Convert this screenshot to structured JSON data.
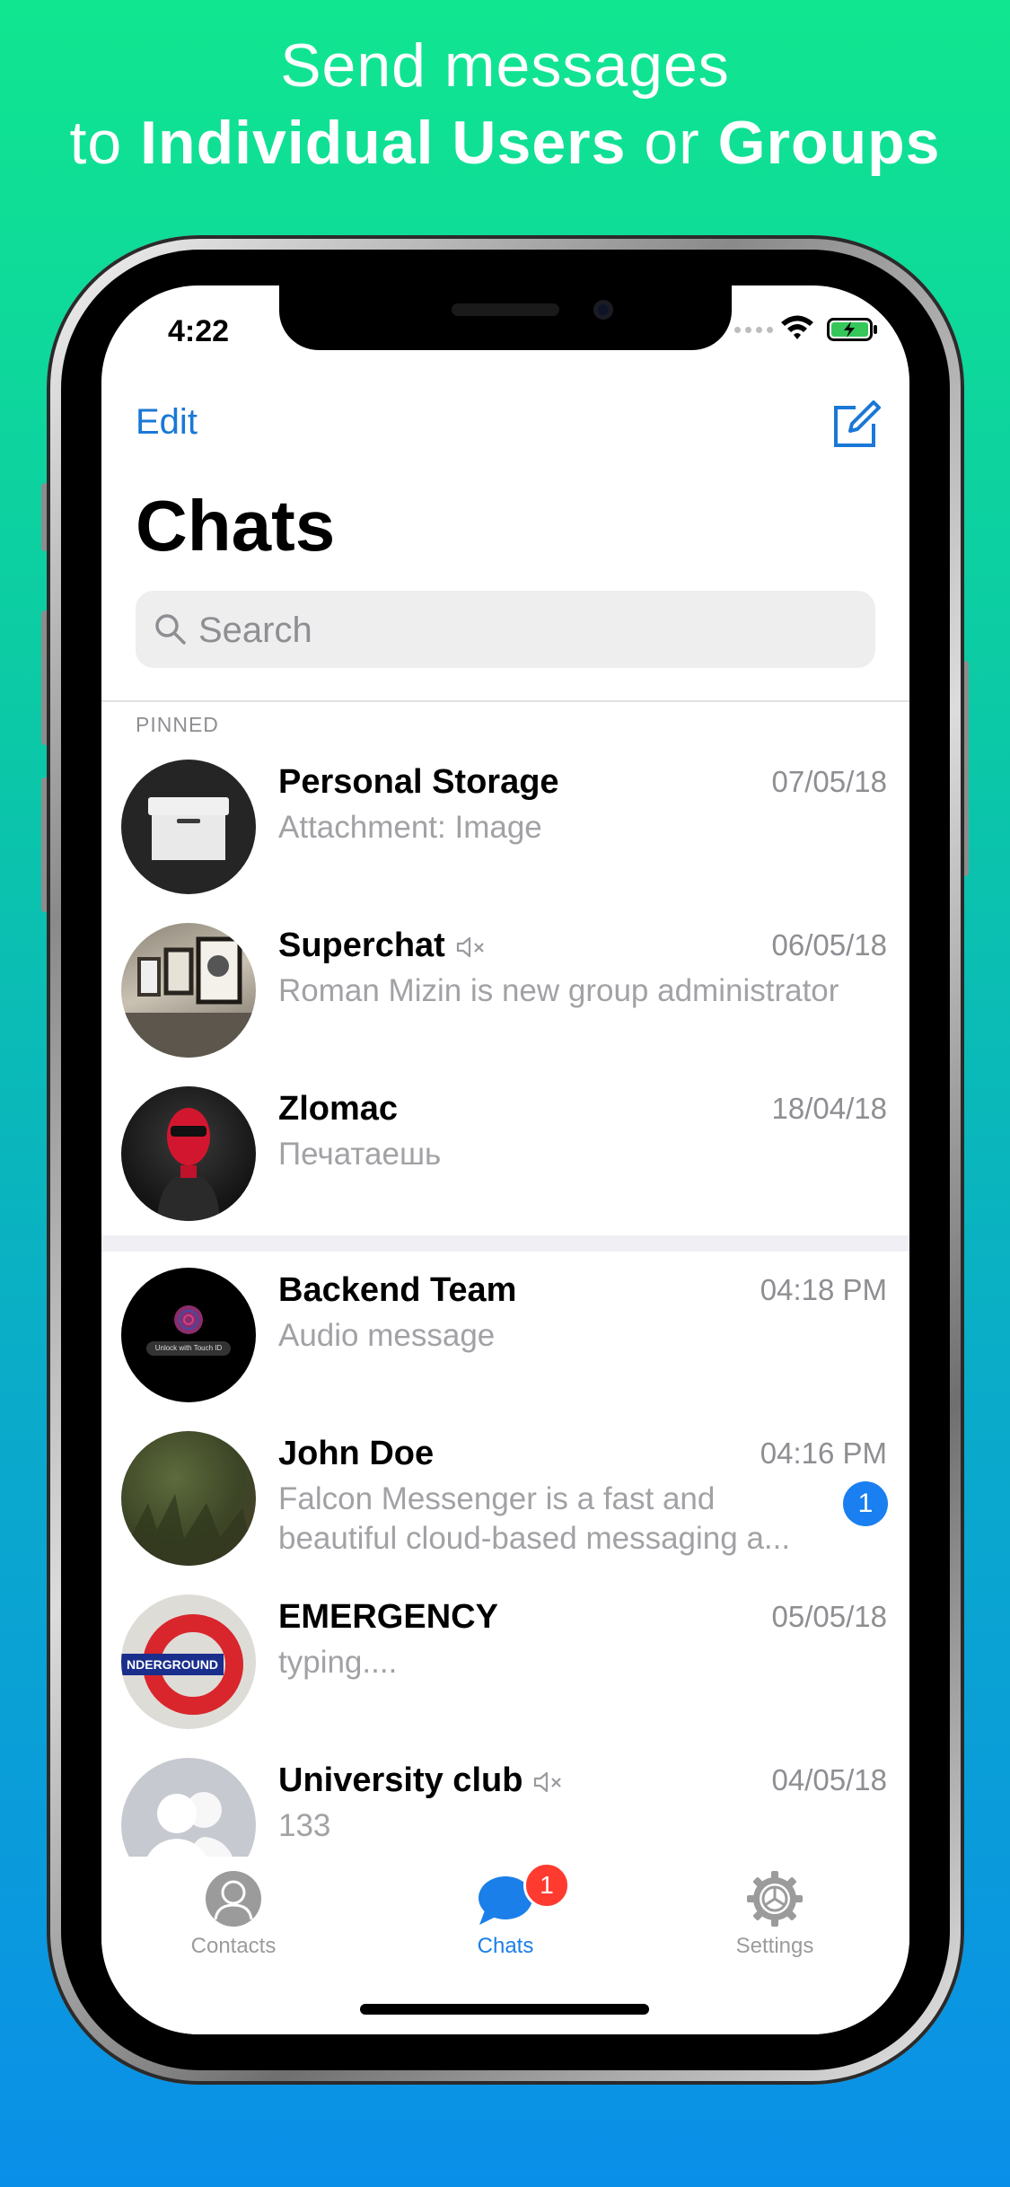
{
  "headline": {
    "line1": "Send messages",
    "line2_prefix": "to ",
    "line2_bold1": "Individual Users",
    "line2_middle": " or ",
    "line2_bold2": "Groups"
  },
  "status_bar": {
    "time": "4:22"
  },
  "nav": {
    "edit_label": "Edit",
    "title": "Chats"
  },
  "search": {
    "placeholder": "Search"
  },
  "section_label": "PINNED",
  "chats": [
    {
      "name": "Personal Storage",
      "date": "07/05/18",
      "preview": "Attachment: Image",
      "muted": false,
      "pinned": true
    },
    {
      "name": "Superchat",
      "date": "06/05/18",
      "preview": "Roman Mizin is new group administrator",
      "muted": true,
      "pinned": true
    },
    {
      "name": "Zlomac",
      "date": "18/04/18",
      "preview": "Печатаешь",
      "muted": false,
      "pinned": true
    },
    {
      "name": "Backend Team",
      "date": "04:18 PM",
      "preview": "Audio message",
      "muted": false,
      "pinned": false
    },
    {
      "name": "John Doe",
      "date": "04:16 PM",
      "preview_line1": "Falcon Messenger is a fast and",
      "preview_line2": "beautiful cloud-based messaging a...",
      "unread": "1",
      "muted": false,
      "pinned": false
    },
    {
      "name": "EMERGENCY",
      "date": "05/05/18",
      "preview": "typing....",
      "muted": false,
      "pinned": false
    },
    {
      "name": "University club",
      "date": "04/05/18",
      "preview": "133",
      "muted": true,
      "pinned": false
    }
  ],
  "avatar_text": {
    "backend_team": "Unlock with Touch ID",
    "emergency": "NDERGROUND"
  },
  "tabbar": {
    "contacts_label": "Contacts",
    "chats_label": "Chats",
    "chats_badge": "1",
    "settings_label": "Settings"
  },
  "colors": {
    "accent": "#1a7fe8",
    "badge_red": "#ff3b30",
    "gradient_top": "#10e690",
    "gradient_bottom": "#0a8fe8"
  }
}
